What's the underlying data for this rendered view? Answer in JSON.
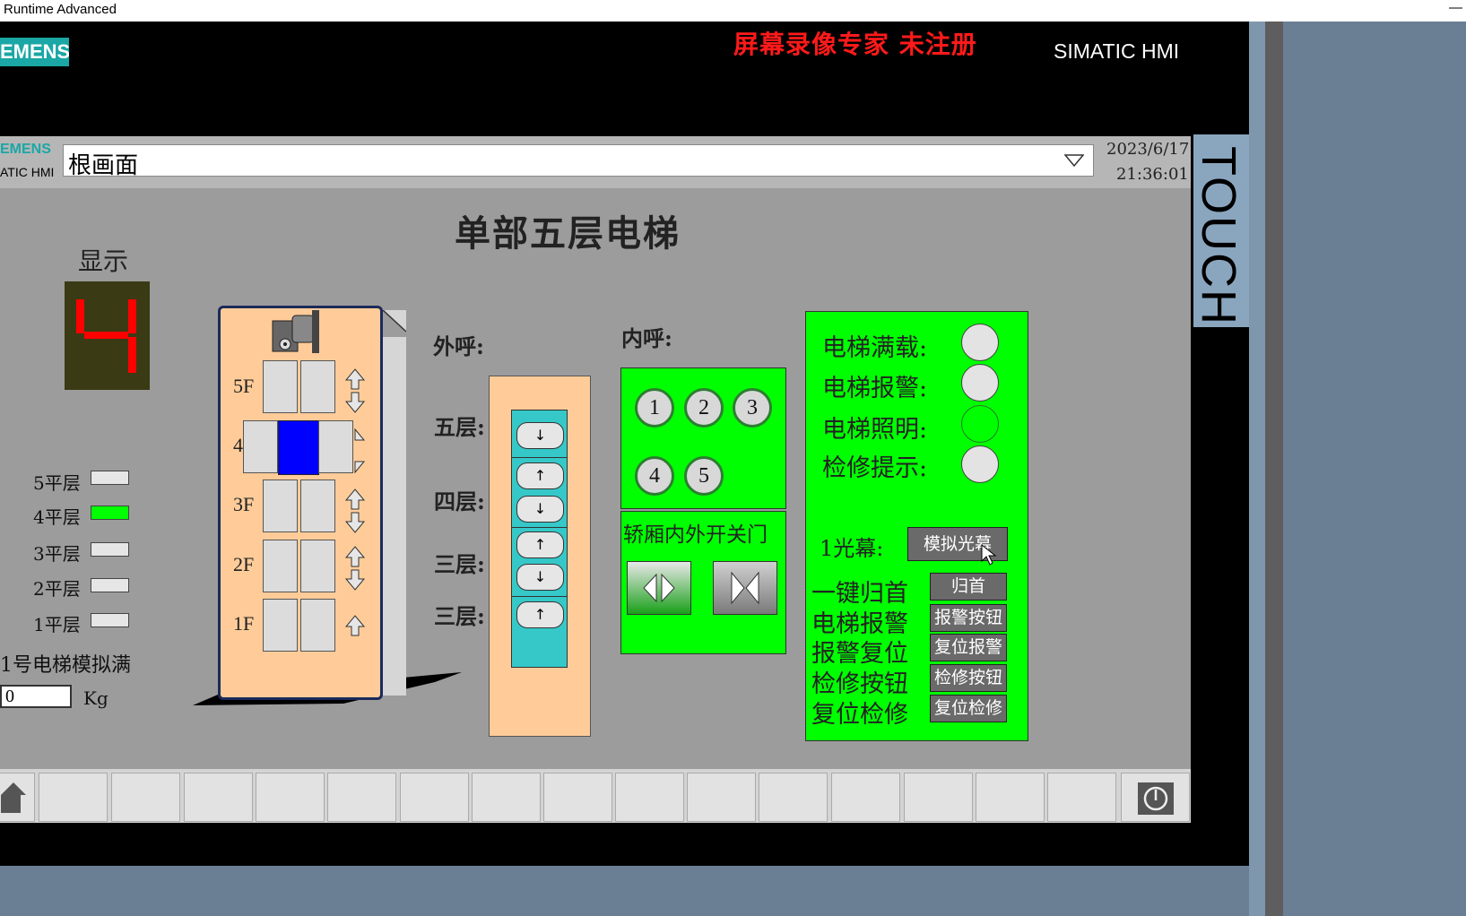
{
  "window": {
    "title": "Runtime Advanced",
    "minimize_glyph": "—"
  },
  "device": {
    "brand": "EMENS",
    "watermark": "屏幕录像专家  未注册",
    "model": "SIMATIC HMI",
    "touch": "TOUCH",
    "colors": {
      "brand_teal": "#1aa7a5",
      "active_green": "#00ff00",
      "car_blue": "#0000ff",
      "segment_red": "#ff0000"
    }
  },
  "header": {
    "brand_top": "EMENS",
    "brand_bottom": "ATIC HMI",
    "screen_name": "根画面",
    "date": "2023/6/17",
    "time": "21:36:01"
  },
  "main": {
    "title": "单部五层电梯",
    "display_label": "显示",
    "current_floor_digit": 4,
    "levels": [
      {
        "label": "5平层",
        "active": false
      },
      {
        "label": "4平层",
        "active": true
      },
      {
        "label": "3平层",
        "active": false
      },
      {
        "label": "2平层",
        "active": false
      },
      {
        "label": "1平层",
        "active": false
      }
    ],
    "weight_sim_label": "1号电梯模拟满",
    "weight_value": "0",
    "weight_unit": "Kg",
    "shaft": {
      "floors": [
        "5F",
        "4",
        "3F",
        "2F",
        "1F"
      ],
      "car_floor": 4
    },
    "external_call": {
      "label": "外呼:",
      "rows": [
        "五层:",
        "四层:",
        "三层:",
        "三层:"
      ],
      "buttons": [
        "↓",
        "↑",
        "↓",
        "↑",
        "↓",
        "↑"
      ]
    },
    "internal_call": {
      "label": "内呼:",
      "buttons": [
        "1",
        "2",
        "3",
        "4",
        "5"
      ]
    },
    "door_control": {
      "label": "轿厢内外开关门"
    },
    "status": {
      "indicators": [
        {
          "label": "电梯满载:",
          "state": "off"
        },
        {
          "label": "电梯报警:",
          "state": "off"
        },
        {
          "label": "电梯照明:",
          "state": "on"
        },
        {
          "label": "检修提示:",
          "state": "off"
        }
      ],
      "light_curtain_label": "1光幕:",
      "light_curtain_button": "模拟光幕",
      "actions": [
        {
          "label": "一键归首",
          "button": "归首"
        },
        {
          "label": "电梯报警",
          "button": "报警按钮"
        },
        {
          "label": "报警复位",
          "button": "复位报警"
        },
        {
          "label": "检修按钮",
          "button": "检修按钮"
        },
        {
          "label": "复位检修",
          "button": "复位检修"
        }
      ]
    }
  }
}
